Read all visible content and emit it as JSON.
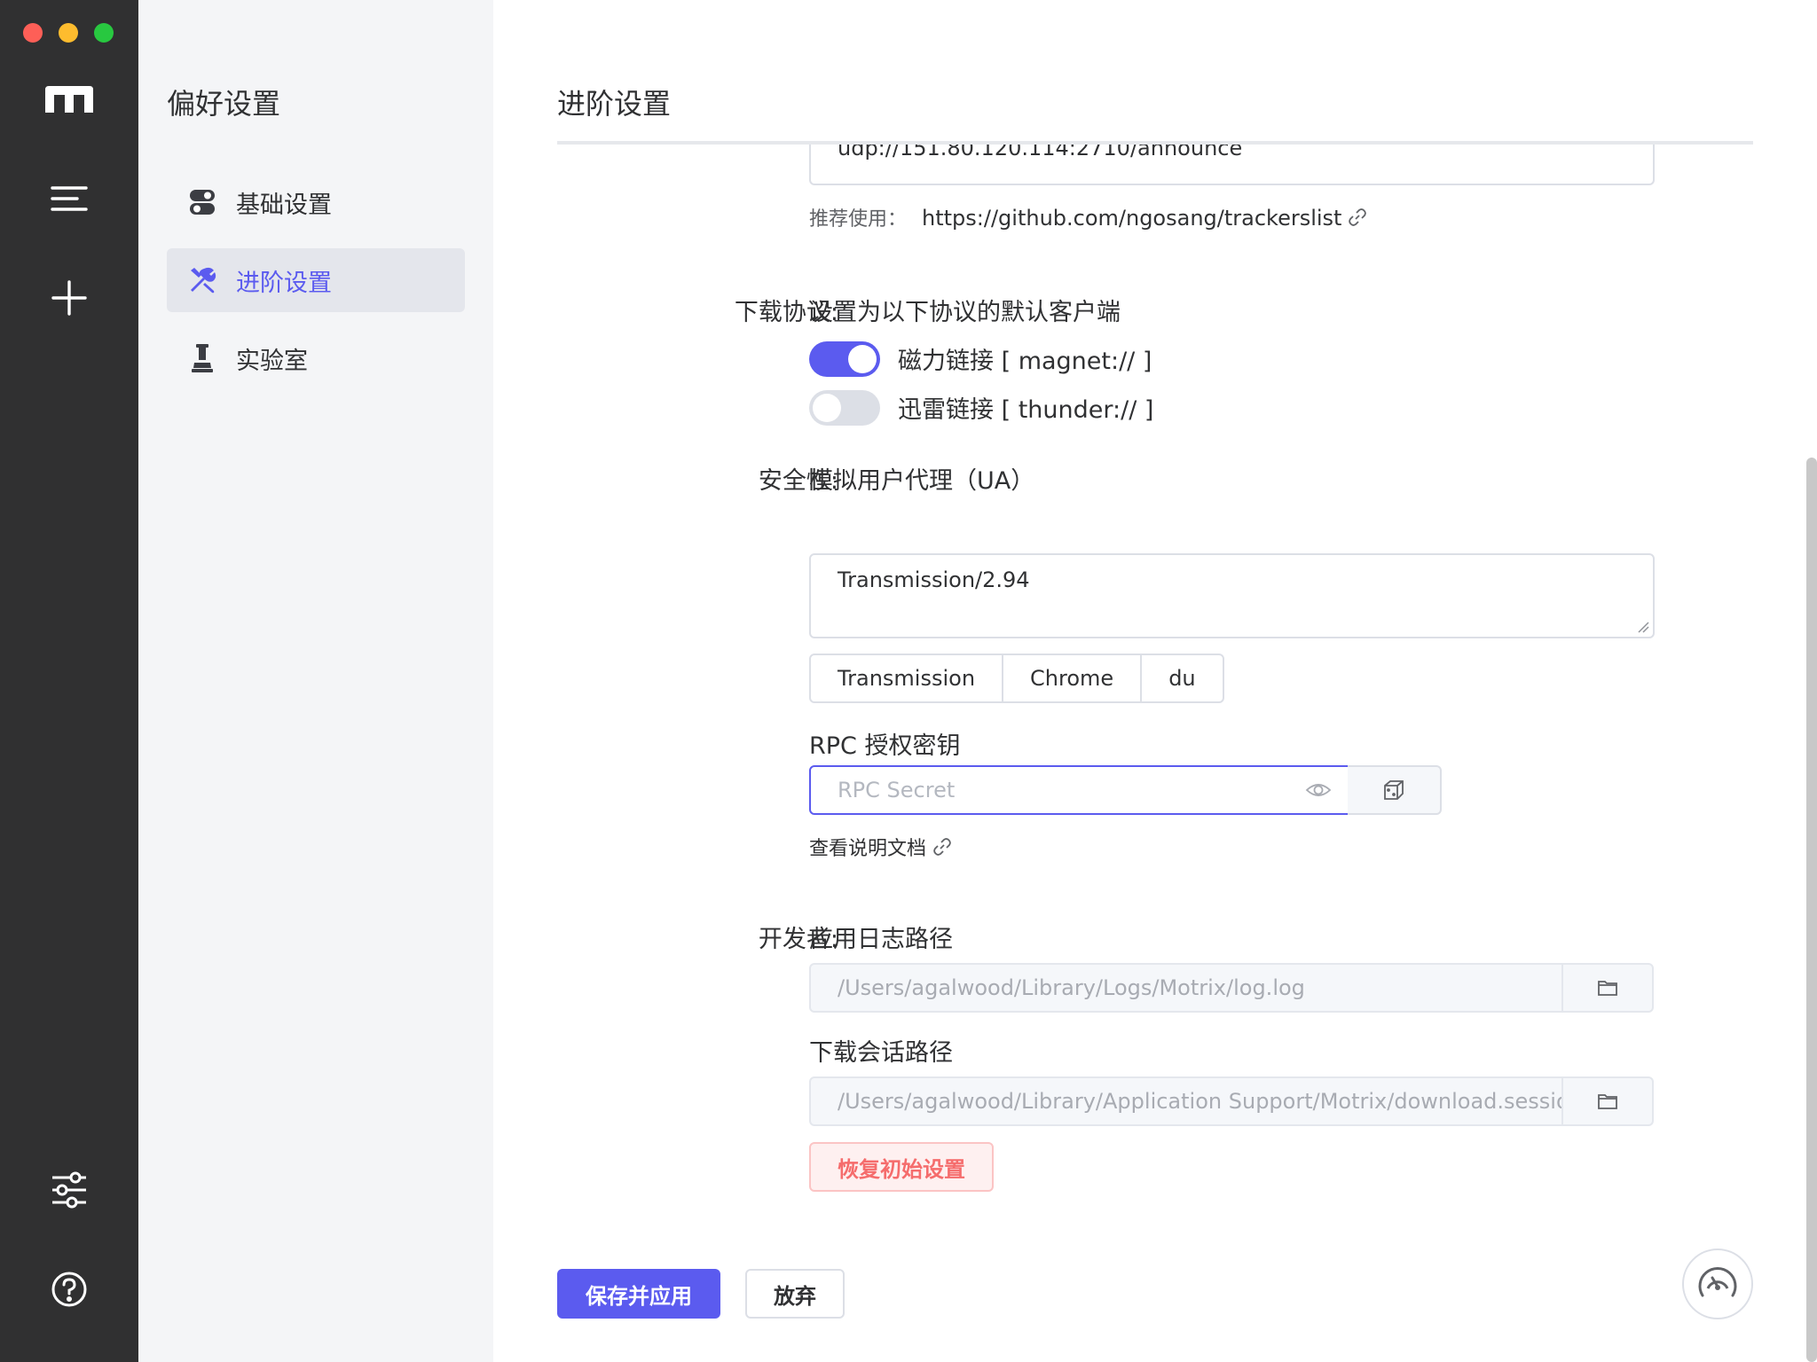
{
  "window": {
    "traffic_lights": [
      "close",
      "minimize",
      "zoom"
    ]
  },
  "rail": {
    "icons": [
      "motrix-logo-icon",
      "menu-icon",
      "plus-icon",
      "sliders-icon",
      "help-icon"
    ]
  },
  "subnav": {
    "title": "偏好设置",
    "items": [
      {
        "label": "基础设置",
        "icon": "toggle-icon",
        "active": false
      },
      {
        "label": "进阶设置",
        "icon": "tools-icon",
        "active": true
      },
      {
        "label": "实验室",
        "icon": "flask-icon",
        "active": false
      }
    ]
  },
  "main": {
    "title": "进阶设置",
    "trackers": {
      "visible_line": "udp://151.80.120.114:2710/announce",
      "hint_label": "推荐使用：",
      "hint_link": "https://github.com/ngosang/trackerslist"
    },
    "protocol": {
      "label": "下载协议:",
      "description": "设置为以下协议的默认客户端",
      "magnet": {
        "label": "磁力链接 [ magnet:// ]",
        "enabled": true
      },
      "thunder": {
        "label": "迅雷链接 [ thunder:// ]",
        "enabled": false
      }
    },
    "security": {
      "label": "安全性:",
      "ua_title": "模拟用户代理（UA）",
      "ua_value": "Transmission/2.94",
      "ua_presets": [
        "Transmission",
        "Chrome",
        "du"
      ],
      "rpc_title": "RPC 授权密钥",
      "rpc_placeholder": "RPC Secret",
      "rpc_value": "",
      "doc_link": "查看说明文档"
    },
    "developer": {
      "label": "开发者:",
      "log_title": "应用日志路径",
      "log_path": "/Users/agalwood/Library/Logs/Motrix/log.log",
      "session_title": "下载会话路径",
      "session_path": "/Users/agalwood/Library/Application Support/Motrix/download.session",
      "reset_label": "恢复初始设置"
    },
    "footer": {
      "save_label": "保存并应用",
      "discard_label": "放弃"
    }
  },
  "colors": {
    "accent": "#5b5bef",
    "rail_bg": "#303031",
    "subnav_bg": "#f4f5f7",
    "danger": "#f56c6c"
  }
}
